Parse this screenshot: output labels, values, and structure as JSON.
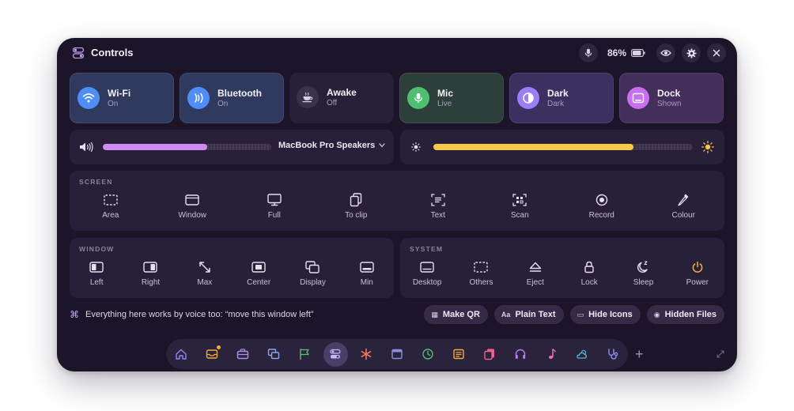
{
  "titlebar": {
    "title": "Controls",
    "battery": "86%",
    "icons": [
      "microphone-icon",
      "battery-icon",
      "eye-icon",
      "gear-icon",
      "close-icon"
    ]
  },
  "toggles": [
    {
      "label": "Wi-Fi",
      "status": "On",
      "icon": "wifi-icon",
      "color": "#4f8ef7"
    },
    {
      "label": "Bluetooth",
      "status": "On",
      "icon": "bluetooth-icon",
      "color": "#4f8ef7"
    },
    {
      "label": "Awake",
      "status": "Off",
      "icon": "coffee-icon",
      "color": "#3a3248"
    },
    {
      "label": "Mic",
      "status": "Live",
      "icon": "microphone-icon",
      "color": "#4fbf6f"
    },
    {
      "label": "Dark",
      "status": "Dark",
      "icon": "contrast-icon",
      "color": "#9b7ef5"
    },
    {
      "label": "Dock",
      "status": "Shown",
      "icon": "dock-icon",
      "color": "#c86ff0"
    }
  ],
  "audio": {
    "device": "MacBook Pro Speakers",
    "volume": 0.62,
    "color": "#d18bf5"
  },
  "brightness": {
    "level": 0.77,
    "color": "#f7c94b"
  },
  "screen": {
    "title": "SCREEN",
    "items": [
      {
        "label": "Area",
        "icon": "dashed-square-icon"
      },
      {
        "label": "Window",
        "icon": "window-icon"
      },
      {
        "label": "Full",
        "icon": "monitor-icon"
      },
      {
        "label": "To clip",
        "icon": "clipboard-icon"
      },
      {
        "label": "Text",
        "icon": "text-scan-icon"
      },
      {
        "label": "Scan",
        "icon": "qr-scan-icon"
      },
      {
        "label": "Record",
        "icon": "record-icon"
      },
      {
        "label": "Colour",
        "icon": "eyedropper-icon"
      }
    ]
  },
  "window": {
    "title": "WINDOW",
    "items": [
      {
        "label": "Left",
        "icon": "snap-left-icon"
      },
      {
        "label": "Right",
        "icon": "snap-right-icon"
      },
      {
        "label": "Max",
        "icon": "maximize-icon"
      },
      {
        "label": "Center",
        "icon": "center-icon"
      },
      {
        "label": "Display",
        "icon": "display-icon"
      },
      {
        "label": "Min",
        "icon": "minimize-icon"
      }
    ]
  },
  "system": {
    "title": "SYSTEM",
    "items": [
      {
        "label": "Desktop",
        "icon": "desktop-icon"
      },
      {
        "label": "Others",
        "icon": "dashed-square-icon"
      },
      {
        "label": "Eject",
        "icon": "eject-icon"
      },
      {
        "label": "Lock",
        "icon": "lock-icon"
      },
      {
        "label": "Sleep",
        "icon": "moon-icon"
      },
      {
        "label": "Power",
        "icon": "power-icon",
        "color": "#f2b43a"
      }
    ]
  },
  "hint": {
    "glyph": "⌘",
    "text": "Everything here works by voice too: “move this window left”"
  },
  "chips": [
    {
      "label": "Make QR",
      "glyph": "▦"
    },
    {
      "label": "Plain Text",
      "glyph": "Aa"
    },
    {
      "label": "Hide Icons",
      "glyph": "▭"
    },
    {
      "label": "Hidden Files",
      "glyph": "◉"
    }
  ],
  "dock": {
    "items": [
      {
        "icon": "home-icon",
        "color": "#8f86f7"
      },
      {
        "icon": "inbox-icon",
        "color": "#f2a93b",
        "badge": true
      },
      {
        "icon": "briefcase-icon",
        "color": "#b48cf0"
      },
      {
        "icon": "windows-icon",
        "color": "#8aa2f7"
      },
      {
        "icon": "flag-icon",
        "color": "#56c27a"
      },
      {
        "icon": "controls-icon",
        "color": "#c9b6ff",
        "selected": true
      },
      {
        "icon": "asterisk-icon",
        "color": "#f07a5a"
      },
      {
        "icon": "browser-icon",
        "color": "#8a8fe0"
      },
      {
        "icon": "clock-icon",
        "color": "#4fbf6f"
      },
      {
        "icon": "notes-icon",
        "color": "#f2a93b"
      },
      {
        "icon": "clipboard-icon",
        "color": "#f0618f"
      },
      {
        "icon": "headphones-icon",
        "color": "#b480f0"
      },
      {
        "icon": "music-icon",
        "color": "#e86fc0"
      },
      {
        "icon": "weather-icon",
        "color": "#56b7d0"
      },
      {
        "icon": "stethoscope-icon",
        "color": "#8a8ff7"
      }
    ],
    "plus": "+"
  }
}
